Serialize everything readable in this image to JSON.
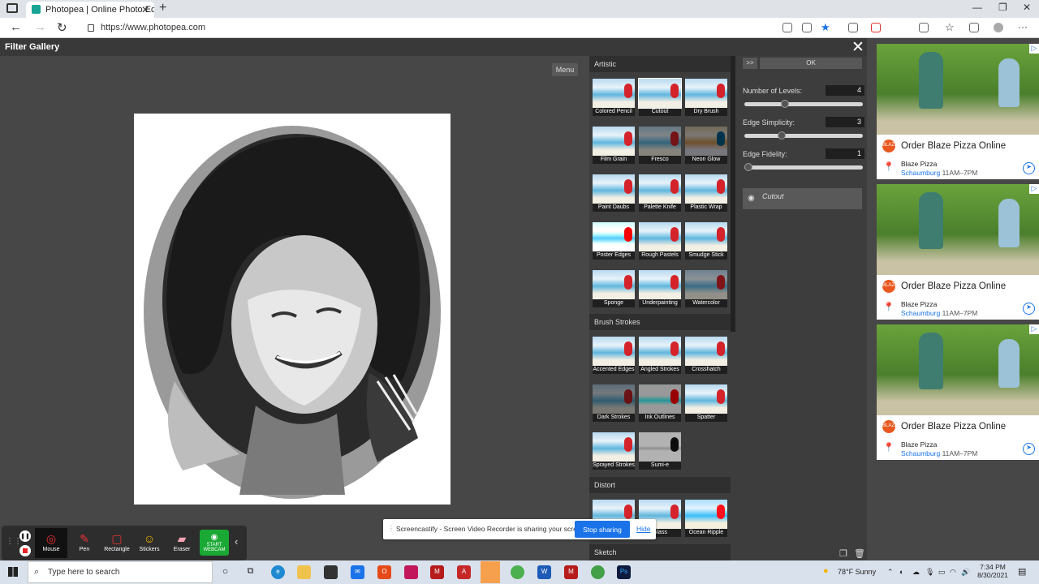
{
  "browser": {
    "tab_title": "Photopea | Online Photo Editor",
    "url": "https://www.photopea.com"
  },
  "filter_gallery": {
    "title": "Filter Gallery",
    "menu_label": "Menu",
    "categories": [
      {
        "name": "Artistic",
        "filters": [
          "Colored Pencil",
          "Cutout",
          "Dry Brush",
          "Film Grain",
          "Fresco",
          "Neon Glow",
          "Paint Daubs",
          "Palette Knife",
          "Plastic Wrap",
          "Poster Edges",
          "Rough Pastels",
          "Smudge Stick",
          "Sponge",
          "Underpainting",
          "Watercolor"
        ]
      },
      {
        "name": "Brush Strokes",
        "filters": [
          "Accented Edges",
          "Angled Strokes",
          "Crosshatch",
          "Dark Strokes",
          "Ink Outlines",
          "Spatter",
          "Sprayed Strokes",
          "Sumi-e"
        ]
      },
      {
        "name": "Distort",
        "filters": [
          "",
          "Glass",
          "Ocean Ripple"
        ]
      },
      {
        "name": "Sketch",
        "filters": []
      }
    ],
    "expand_label": ">>",
    "ok_label": "OK",
    "params": [
      {
        "label": "Number of Levels:",
        "value": "4",
        "level": 0.33
      },
      {
        "label": "Edge Simplicity:",
        "value": "3",
        "level": 0.3
      },
      {
        "label": "Edge Fidelity:",
        "value": "1",
        "level": 0.0
      }
    ],
    "applied_layer": "Cutout"
  },
  "ads": [
    {
      "headline": "Order Blaze Pizza Online",
      "brand": "Blaze Pizza",
      "location": "Schaumburg",
      "hours": "11AM–7PM",
      "logo_text": "BLAZE"
    },
    {
      "headline": "Order Blaze Pizza Online",
      "brand": "Blaze Pizza",
      "location": "Schaumburg",
      "hours": "11AM–7PM",
      "logo_text": "BLAZE"
    },
    {
      "headline": "Order Blaze Pizza Online",
      "brand": "Blaze Pizza",
      "location": "Schaumburg",
      "hours": "11AM–7PM",
      "logo_text": "BLAZE"
    }
  ],
  "screencastify": {
    "tools": [
      "Mouse",
      "Pen",
      "Rectangle",
      "Stickers",
      "Eraser",
      "START WEBCAM"
    ],
    "share_message": "Screencastify - Screen Video Recorder is sharing your screen.",
    "stop_label": "Stop sharing",
    "hide_label": "Hide"
  },
  "taskbar": {
    "search_placeholder": "Type here to search",
    "weather": "78°F  Sunny",
    "time": "7:34 PM",
    "date": "8/30/2021"
  }
}
